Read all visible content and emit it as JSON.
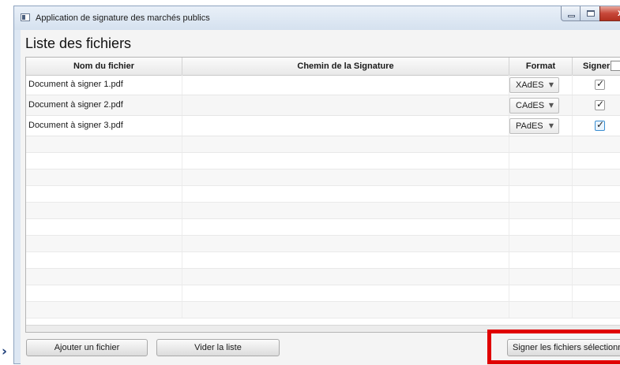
{
  "window": {
    "title": "Application de signature des marchés publics",
    "close_label": "x"
  },
  "section_title": "Liste des fichiers",
  "table": {
    "columns": [
      "Nom du fichier",
      "Chemin de la Signature",
      "Format",
      "Signer"
    ],
    "rows": [
      {
        "name": "Document à signer 1.pdf",
        "path": "",
        "format": "XAdES",
        "signed": true
      },
      {
        "name": "Document à signer 2.pdf",
        "path": "",
        "format": "CAdES",
        "signed": true
      },
      {
        "name": "Document à signer 3.pdf",
        "path": "",
        "format": "PAdES",
        "signed": true
      }
    ],
    "checkmark": "✓",
    "combo_arrow": "▼"
  },
  "buttons": {
    "add": "Ajouter un fichier",
    "clear": "Vider la liste",
    "sign": "Signer les fichiers sélectionnés"
  },
  "arrow_glyph": "›",
  "colors": {
    "highlight": "#e00000",
    "focus": "#3a8dd0"
  }
}
